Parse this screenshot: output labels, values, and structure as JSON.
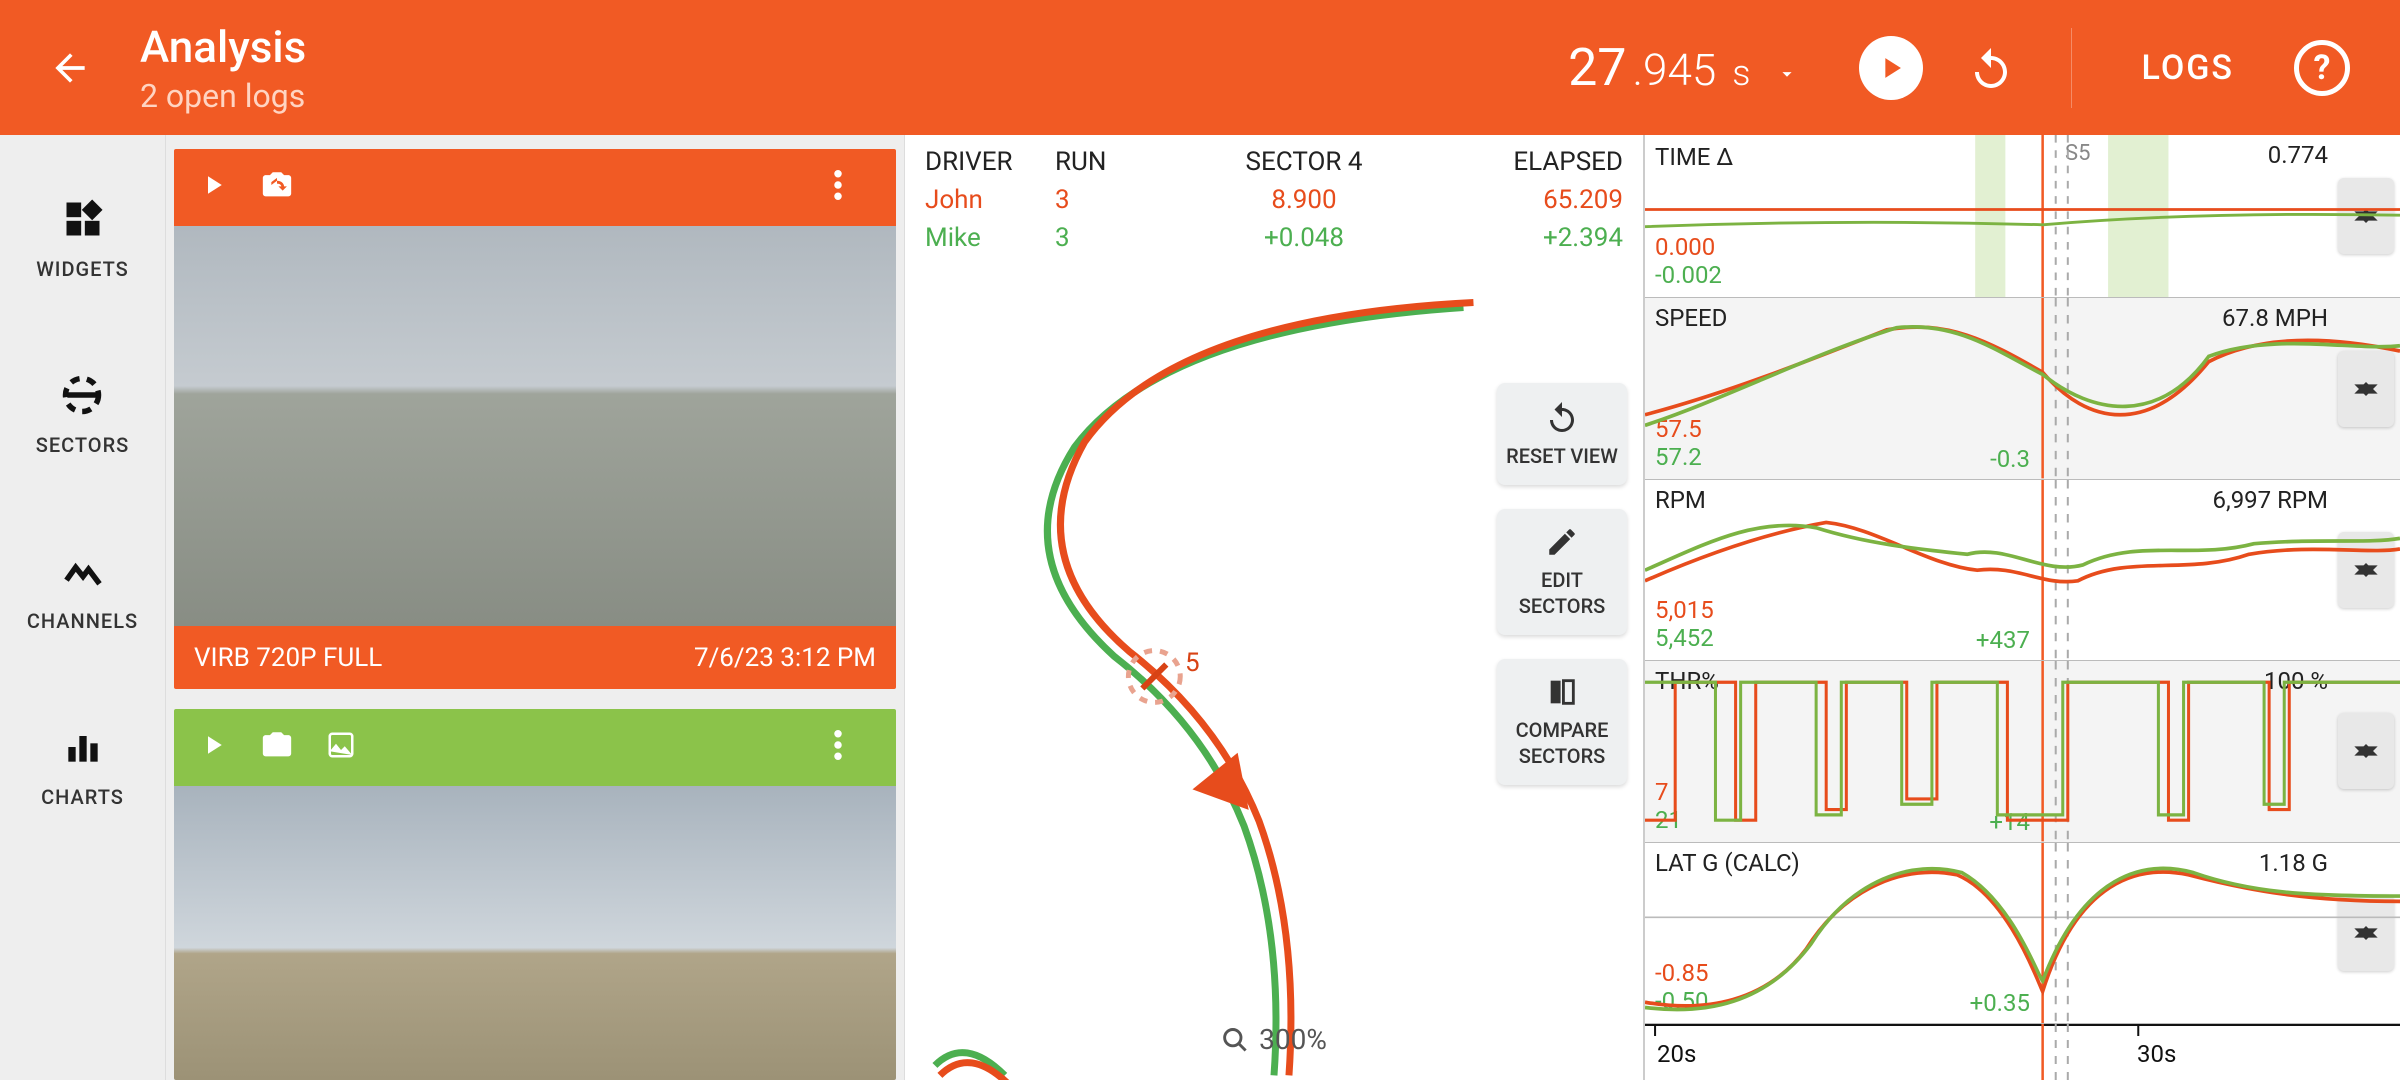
{
  "header": {
    "title": "Analysis",
    "subtitle": "2 open logs",
    "time_big": "27",
    "time_frac": ".945",
    "time_unit": "s",
    "logs_btn": "LOGS"
  },
  "sidebar": {
    "widgets": "WIDGETS",
    "sectors": "SECTORS",
    "channels": "CHANNELS",
    "charts": "CHARTS"
  },
  "video": {
    "card1": {
      "caption_left": "VIRB 720P FULL",
      "caption_right": "7/6/23 3:12 PM"
    }
  },
  "track": {
    "hdr": {
      "driver": "DRIVER",
      "run": "RUN",
      "sector": "SECTOR 4",
      "elapsed": "ELAPSED"
    },
    "row1": {
      "driver": "John",
      "run": "3",
      "sector": "8.900",
      "elapsed": "65.209"
    },
    "row2": {
      "driver": "Mike",
      "run": "3",
      "sector": "+0.048",
      "elapsed": "+2.394"
    },
    "marker5": "5",
    "reset_view": "RESET VIEW",
    "edit_sectors": "EDIT SECTORS",
    "compare_sectors": "COMPARE SECTORS",
    "zoom": "300%"
  },
  "charts": {
    "sector_far_right": "0.774",
    "s5_label": "S5",
    "timedelta": {
      "title": "TIME Δ",
      "v1": "0.000",
      "v2": "-0.002"
    },
    "speed": {
      "title": "SPEED",
      "right": "67.8 MPH",
      "v1": "57.5",
      "v2": "57.2",
      "delta": "-0.3"
    },
    "rpm": {
      "title": "RPM",
      "right": "6,997 RPM",
      "v1": "5,015",
      "v2": "5,452",
      "delta": "+437"
    },
    "thr": {
      "title": "THR%",
      "right": "100 %",
      "v1": "7",
      "v2": "21",
      "delta": "+14"
    },
    "latg": {
      "title": "LAT G (CALC)",
      "right": "1.18 G",
      "v1": "-0.85",
      "v2": "-0.50",
      "delta": "+0.35"
    },
    "axis": {
      "t1": "20s",
      "t2": "30s"
    }
  },
  "chart_data": [
    {
      "type": "line",
      "title": "TIME Δ",
      "x_range_s": [
        18,
        36
      ],
      "series": [
        {
          "name": "John",
          "color": "#e74c1c",
          "values_at_cursor": 0.0
        },
        {
          "name": "Mike",
          "color": "#4caf50",
          "values_at_cursor": -0.002
        }
      ]
    },
    {
      "type": "line",
      "title": "SPEED",
      "ylabel": "MPH",
      "x_range_s": [
        18,
        36
      ],
      "series": [
        {
          "name": "John",
          "color": "#e74c1c",
          "values_at_cursor": 57.5
        },
        {
          "name": "Mike",
          "color": "#4caf50",
          "values_at_cursor": 57.2
        }
      ],
      "value_right": 67.8,
      "delta": -0.3
    },
    {
      "type": "line",
      "title": "RPM",
      "x_range_s": [
        18,
        36
      ],
      "series": [
        {
          "name": "John",
          "color": "#e74c1c",
          "values_at_cursor": 5015
        },
        {
          "name": "Mike",
          "color": "#4caf50",
          "values_at_cursor": 5452
        }
      ],
      "value_right": 6997,
      "delta": 437
    },
    {
      "type": "line",
      "title": "THR%",
      "ylim": [
        0,
        100
      ],
      "x_range_s": [
        18,
        36
      ],
      "series": [
        {
          "name": "John",
          "color": "#e74c1c",
          "values_at_cursor": 7
        },
        {
          "name": "Mike",
          "color": "#4caf50",
          "values_at_cursor": 21
        }
      ],
      "value_right": 100,
      "delta": 14
    },
    {
      "type": "line",
      "title": "LAT G (CALC)",
      "x_range_s": [
        18,
        36
      ],
      "series": [
        {
          "name": "John",
          "color": "#e74c1c",
          "values_at_cursor": -0.85
        },
        {
          "name": "Mike",
          "color": "#4caf50",
          "values_at_cursor": -0.5
        }
      ],
      "value_right": 1.18,
      "delta": 0.35
    }
  ],
  "colors": {
    "accent": "#f15a24",
    "driver1": "#e74c1c",
    "driver2": "#8bc34a"
  }
}
